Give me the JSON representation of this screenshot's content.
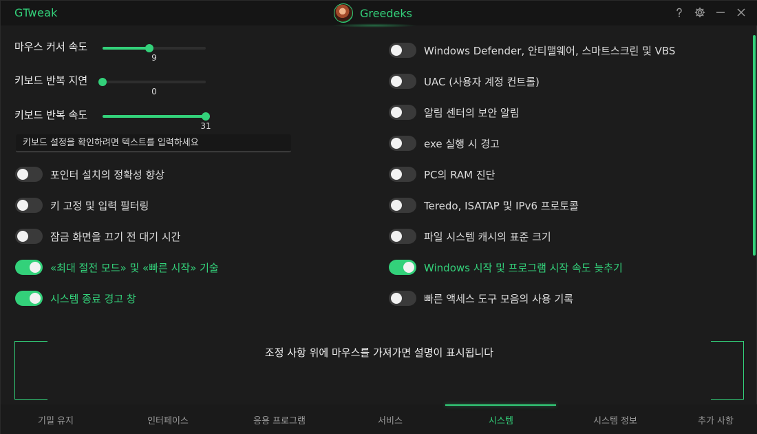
{
  "app": {
    "title": "GTweak",
    "user_name": "Greedeks"
  },
  "window_controls": {
    "help_icon": "question-icon",
    "settings_icon": "gear-icon",
    "minimize_icon": "minimize-icon",
    "close_icon": "close-icon"
  },
  "sliders": [
    {
      "label": "마우스 커서 속도",
      "value": "9",
      "fraction": 0.45
    },
    {
      "label": "키보드 반복 지연",
      "value": "0",
      "fraction": 0.0
    },
    {
      "label": "키보드 반복 속도",
      "value": "31",
      "fraction": 1.0
    }
  ],
  "test_input": {
    "placeholder": "키보드 설정을 확인하려면 텍스트를 입력하세요"
  },
  "left_toggles": [
    {
      "label": "포인터 설치의 정확성 향상",
      "on": false
    },
    {
      "label": "키 고정 및 입력 필터링",
      "on": false
    },
    {
      "label": "잠금 화면을 끄기 전 대기 시간",
      "on": false
    },
    {
      "label": "«최대 절전 모드» 및 «빠른 시작» 기술",
      "on": true
    },
    {
      "label": "시스템 종료 경고 창",
      "on": true
    }
  ],
  "right_toggles": [
    {
      "label": "Windows Defender, 안티맬웨어, 스마트스크린 및 VBS",
      "on": false
    },
    {
      "label": "UAC (사용자 계정 컨트롤)",
      "on": false
    },
    {
      "label": "알림 센터의 보안 알림",
      "on": false
    },
    {
      "label": "exe 실행 시 경고",
      "on": false
    },
    {
      "label": "PC의 RAM 진단",
      "on": false
    },
    {
      "label": "Teredo, ISATAP 및 IPv6 프로토콜",
      "on": false
    },
    {
      "label": "파일 시스템 캐시의 표준 크기",
      "on": false
    },
    {
      "label": "Windows 시작 및 프로그램 시작 속도 늦추기",
      "on": true
    },
    {
      "label": "빠른 액세스 도구 모음의 사용 기록",
      "on": false
    }
  ],
  "description": {
    "text": "조정 사항 위에 마우스를 가져가면 설명이 표시됩니다"
  },
  "tabs": [
    {
      "label": "기밀 유지",
      "active": false
    },
    {
      "label": "인터페이스",
      "active": false
    },
    {
      "label": "응용 프로그램",
      "active": false
    },
    {
      "label": "서비스",
      "active": false
    },
    {
      "label": "시스템",
      "active": true
    },
    {
      "label": "시스템 정보",
      "active": false
    },
    {
      "label": "추가 사항",
      "active": false
    }
  ],
  "colors": {
    "accent": "#33d17a",
    "background": "#1c1c1c",
    "toggle_off": "#3a3a3a"
  }
}
